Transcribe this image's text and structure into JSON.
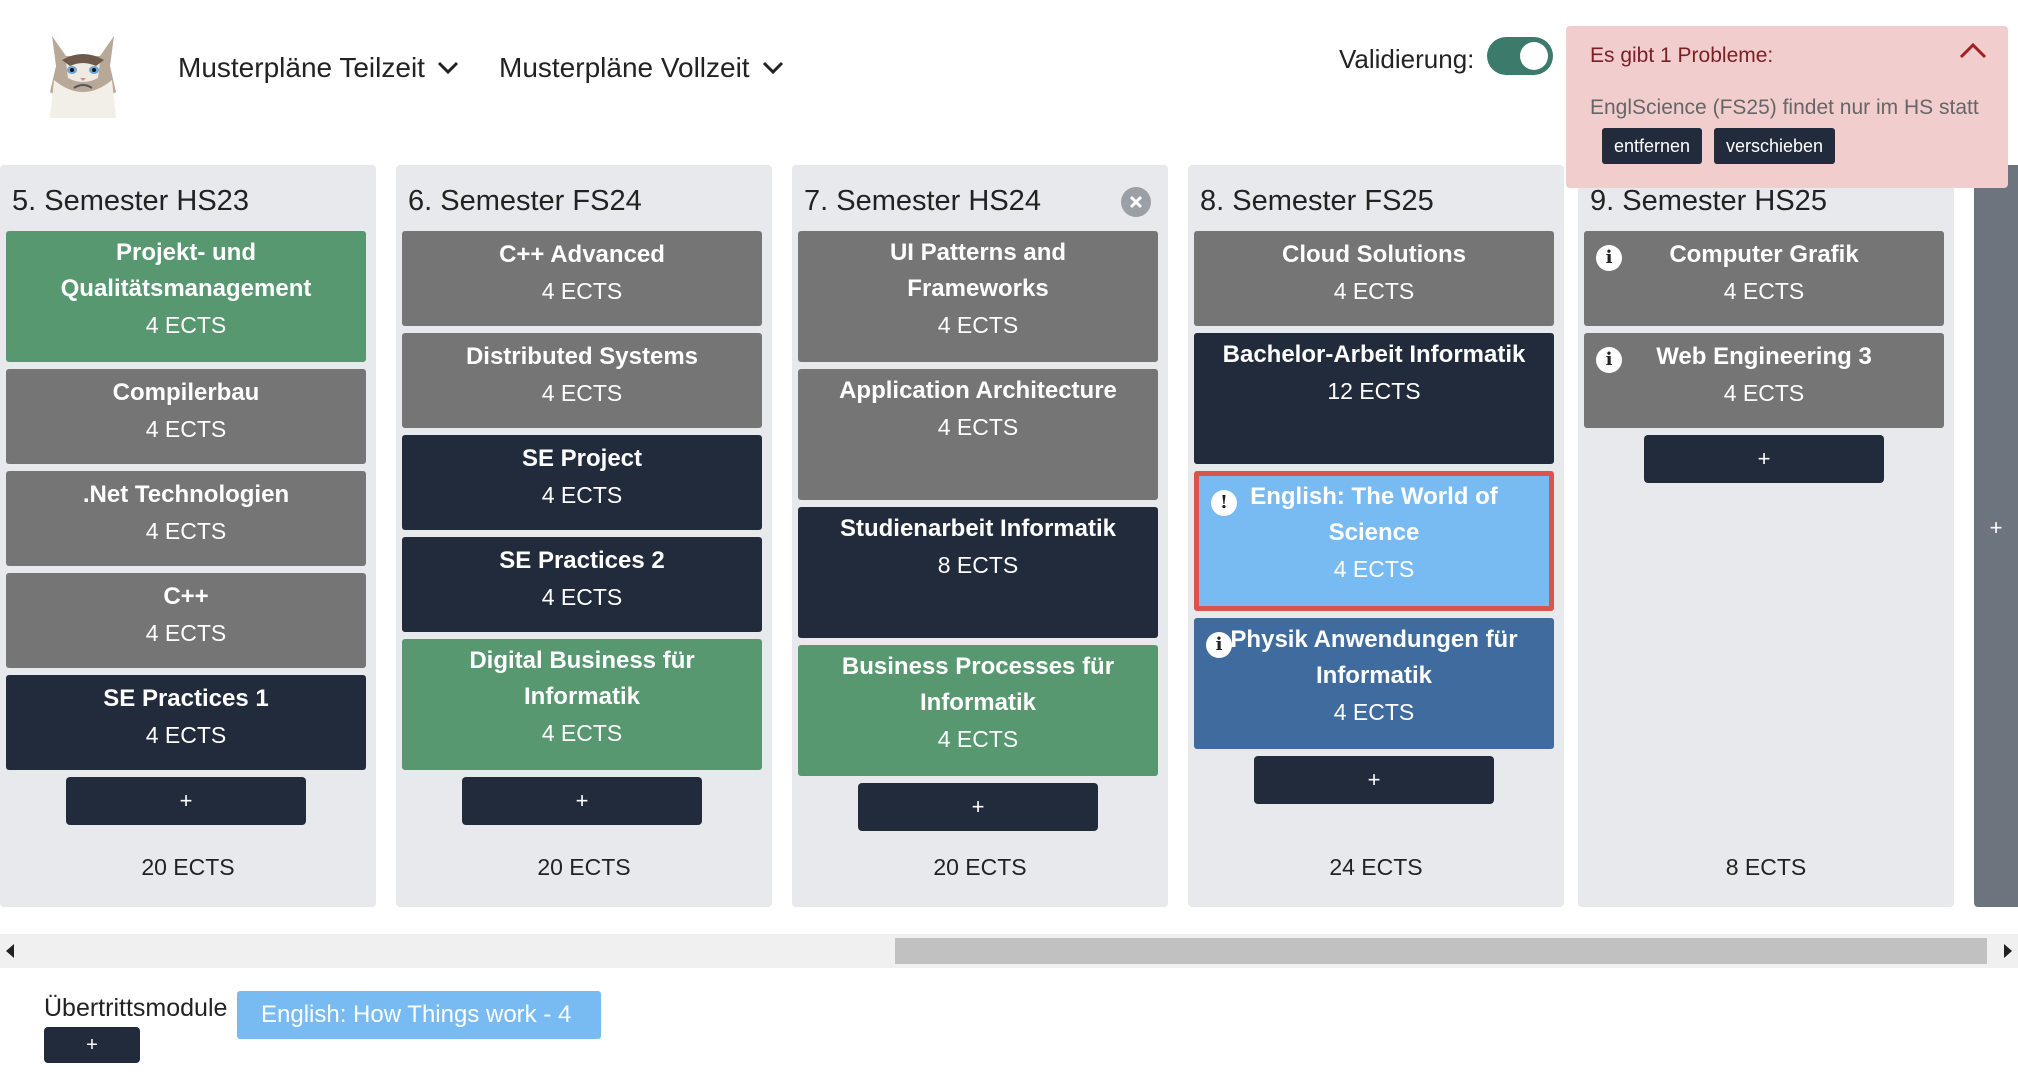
{
  "header": {
    "logo_icon": "grumpy-cat-avatar",
    "nav": [
      {
        "label": "Musterpläne Teilzeit",
        "icon": "chevron-down-icon"
      },
      {
        "label": "Musterpläne Vollzeit",
        "icon": "chevron-down-icon"
      }
    ],
    "validation_label": "Validierung:",
    "validation_enabled": true
  },
  "alert": {
    "title": "Es gibt 1 Probleme:",
    "message": "EnglScience (FS25) findet nur im HS statt",
    "remove_label": "entfernen",
    "move_label": "verschieben",
    "icon": "chevron-up-icon"
  },
  "colors": {
    "mandatory": "#757575",
    "core": "#222b3c",
    "elective": "#579870",
    "english": "#78bbf3",
    "physics": "#3f6b9e",
    "error_border": "#d9534f"
  },
  "semesters": [
    {
      "title": "5. Semester HS23",
      "total": "20 ECTS",
      "modules": [
        {
          "name": "Projekt- und Qualitätsmanagement",
          "ects": "4 ECTS"
        },
        {
          "name": "Compilerbau",
          "ects": "4 ECTS"
        },
        {
          "name": ".Net Technologien",
          "ects": "4 ECTS"
        },
        {
          "name": "C++",
          "ects": "4 ECTS"
        },
        {
          "name": "SE Practices 1",
          "ects": "4 ECTS"
        }
      ]
    },
    {
      "title": "6. Semester FS24",
      "total": "20 ECTS",
      "modules": [
        {
          "name": "C++ Advanced",
          "ects": "4 ECTS"
        },
        {
          "name": "Distributed Systems",
          "ects": "4 ECTS"
        },
        {
          "name": "SE Project",
          "ects": "4 ECTS"
        },
        {
          "name": "SE Practices 2",
          "ects": "4 ECTS"
        },
        {
          "name": "Digital Business für Informatik",
          "ects": "4 ECTS"
        }
      ]
    },
    {
      "title": "7. Semester HS24",
      "total": "20 ECTS",
      "remove_icon": "close-icon",
      "modules": [
        {
          "name": "UI Patterns and Frameworks",
          "ects": "4 ECTS"
        },
        {
          "name": "Application Architecture",
          "ects": "4 ECTS"
        },
        {
          "name": "Studienarbeit Informatik",
          "ects": "8 ECTS"
        },
        {
          "name": "Business Processes für Informatik",
          "ects": "4 ECTS"
        }
      ]
    },
    {
      "title": "8. Semester FS25",
      "total": "24 ECTS",
      "modules": [
        {
          "name": "Cloud Solutions",
          "ects": "4 ECTS"
        },
        {
          "name": "Bachelor-Arbeit Informatik",
          "ects": "12 ECTS"
        },
        {
          "name": "English: The World of Science",
          "ects": "4 ECTS",
          "icon": "warning-icon"
        },
        {
          "name": "Physik Anwendungen für Informatik",
          "ects": "4 ECTS",
          "icon": "info-icon"
        }
      ]
    },
    {
      "title": "9. Semester HS25",
      "total": "8 ECTS",
      "modules": [
        {
          "name": "Computer Grafik",
          "ects": "4 ECTS",
          "icon": "info-icon"
        },
        {
          "name": "Web Engineering 3",
          "ects": "4 ECTS",
          "icon": "info-icon"
        }
      ]
    }
  ],
  "add_label": "+",
  "add_semester_label": "+",
  "transfer": {
    "label": "Übertrittsmodule",
    "chip": "English: How Things work  -  4",
    "add_label": "+"
  }
}
